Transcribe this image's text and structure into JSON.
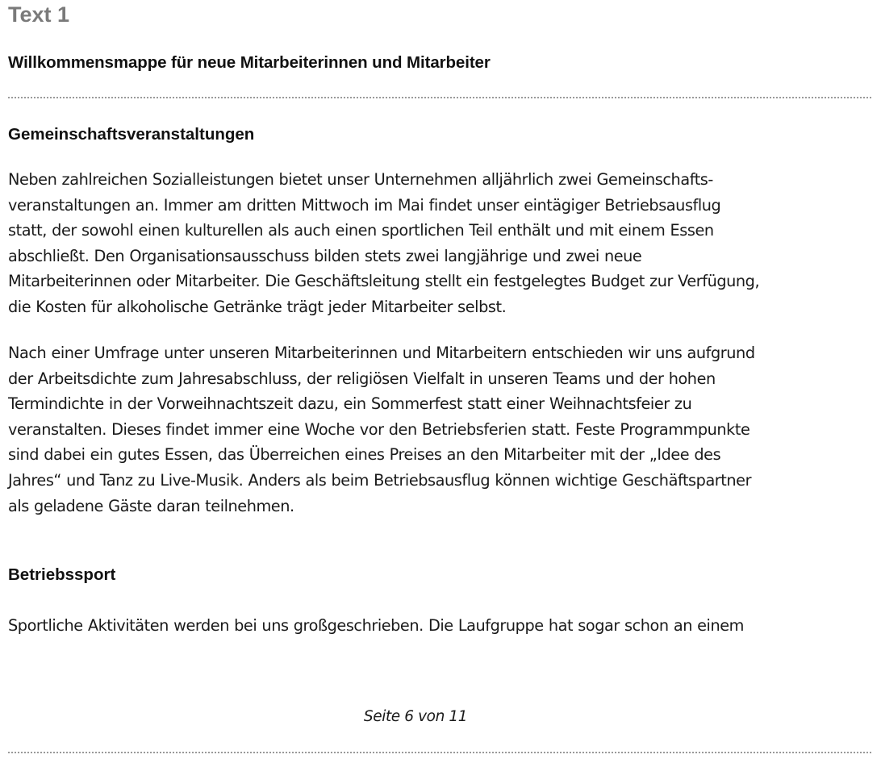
{
  "header": {
    "text_label": "Text 1",
    "title": "Willkommensmappe für neue Mitarbeiterinnen und Mitarbeiter"
  },
  "sections": [
    {
      "heading": "Gemeinschaftsveranstaltungen",
      "paragraphs": [
        {
          "lines": [
            "Neben zahlreichen Sozialleistungen bietet unser Unternehmen alljährlich zwei Gemeinschafts-",
            "veranstaltungen an. Immer am dritten Mittwoch im Mai findet unser eintägiger Betriebsausflug",
            "statt, der sowohl einen kulturellen als auch einen sportlichen Teil enthält und mit einem Essen",
            "abschließt. Den Organisationsausschuss bilden stets zwei langjährige und zwei neue",
            "Mitarbeiterinnen oder Mitarbeiter. Die Geschäftsleitung stellt ein festgelegtes Budget zur Verfügung,",
            "die Kosten für alkoholische Getränke trägt jeder Mitarbeiter selbst."
          ]
        },
        {
          "lines": [
            "Nach einer Umfrage unter unseren Mitarbeiterinnen und Mitarbeitern entschieden wir uns aufgrund",
            "der Arbeitsdichte zum Jahresabschluss, der religiösen Vielfalt in unseren Teams und der hohen",
            "Termindichte in der Vorweihnachtszeit dazu, ein Sommerfest statt einer Weihnachtsfeier zu",
            "veranstalten. Dieses findet immer eine Woche vor den Betriebsferien statt. Feste Programmpunkte",
            "sind dabei ein gutes Essen, das Überreichen eines Preises an den Mitarbeiter mit der „Idee des",
            "Jahres“ und Tanz zu Live-Musik. Anders als beim Betriebsausflug können wichtige Geschäftspartner",
            "als geladene Gäste daran teilnehmen."
          ]
        }
      ]
    },
    {
      "heading": "Betriebssport",
      "paragraphs": [
        {
          "lines": [
            "Sportliche Aktivitäten werden bei uns großgeschrieben. Die Laufgruppe hat sogar schon an einem"
          ]
        }
      ]
    }
  ],
  "footer": {
    "page_indicator": "Seite 6 von 11"
  }
}
